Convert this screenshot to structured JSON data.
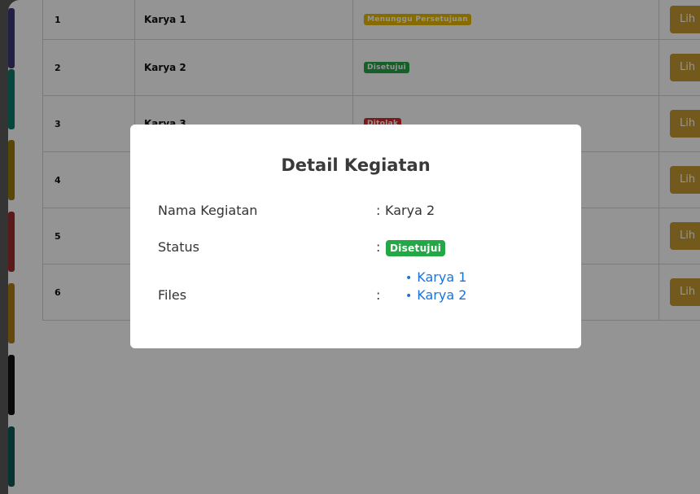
{
  "colors": {
    "stripes": [
      "#3a3a78",
      "#0f7a6a",
      "#9b7a0a",
      "#9b2d2d",
      "#b07a15",
      "#111111",
      "#0c5a55"
    ],
    "approved": "#22a845",
    "pending": "#e6b800",
    "rejected": "#d32f2f",
    "action_button": "#c69a30",
    "link": "#1a73d9"
  },
  "table": {
    "rows": [
      {
        "no": "1",
        "name": "Karya 1",
        "status": "Menunggu Persetujuan",
        "status_type": "pending",
        "action": "Lih"
      },
      {
        "no": "2",
        "name": "Karya 2",
        "status": "Disetujui",
        "status_type": "approved",
        "action": "Lih"
      },
      {
        "no": "3",
        "name": "Karya 3",
        "status": "Ditolak",
        "status_type": "rejected",
        "action": "Lih"
      },
      {
        "no": "4",
        "name": "",
        "status": "",
        "status_type": "",
        "action": "Lih"
      },
      {
        "no": "5",
        "name": "",
        "status": "",
        "status_type": "",
        "action": "Lih"
      },
      {
        "no": "6",
        "name": "",
        "status": "",
        "status_type": "",
        "action": "Lih"
      }
    ]
  },
  "modal": {
    "title": "Detail Kegiatan",
    "name_label": "Nama Kegiatan",
    "name_value": "Karya 2",
    "status_label": "Status",
    "status_value": "Disetujui",
    "files_label": "Files",
    "colon": ":",
    "files": [
      "Karya 1",
      "Karya 2"
    ]
  }
}
